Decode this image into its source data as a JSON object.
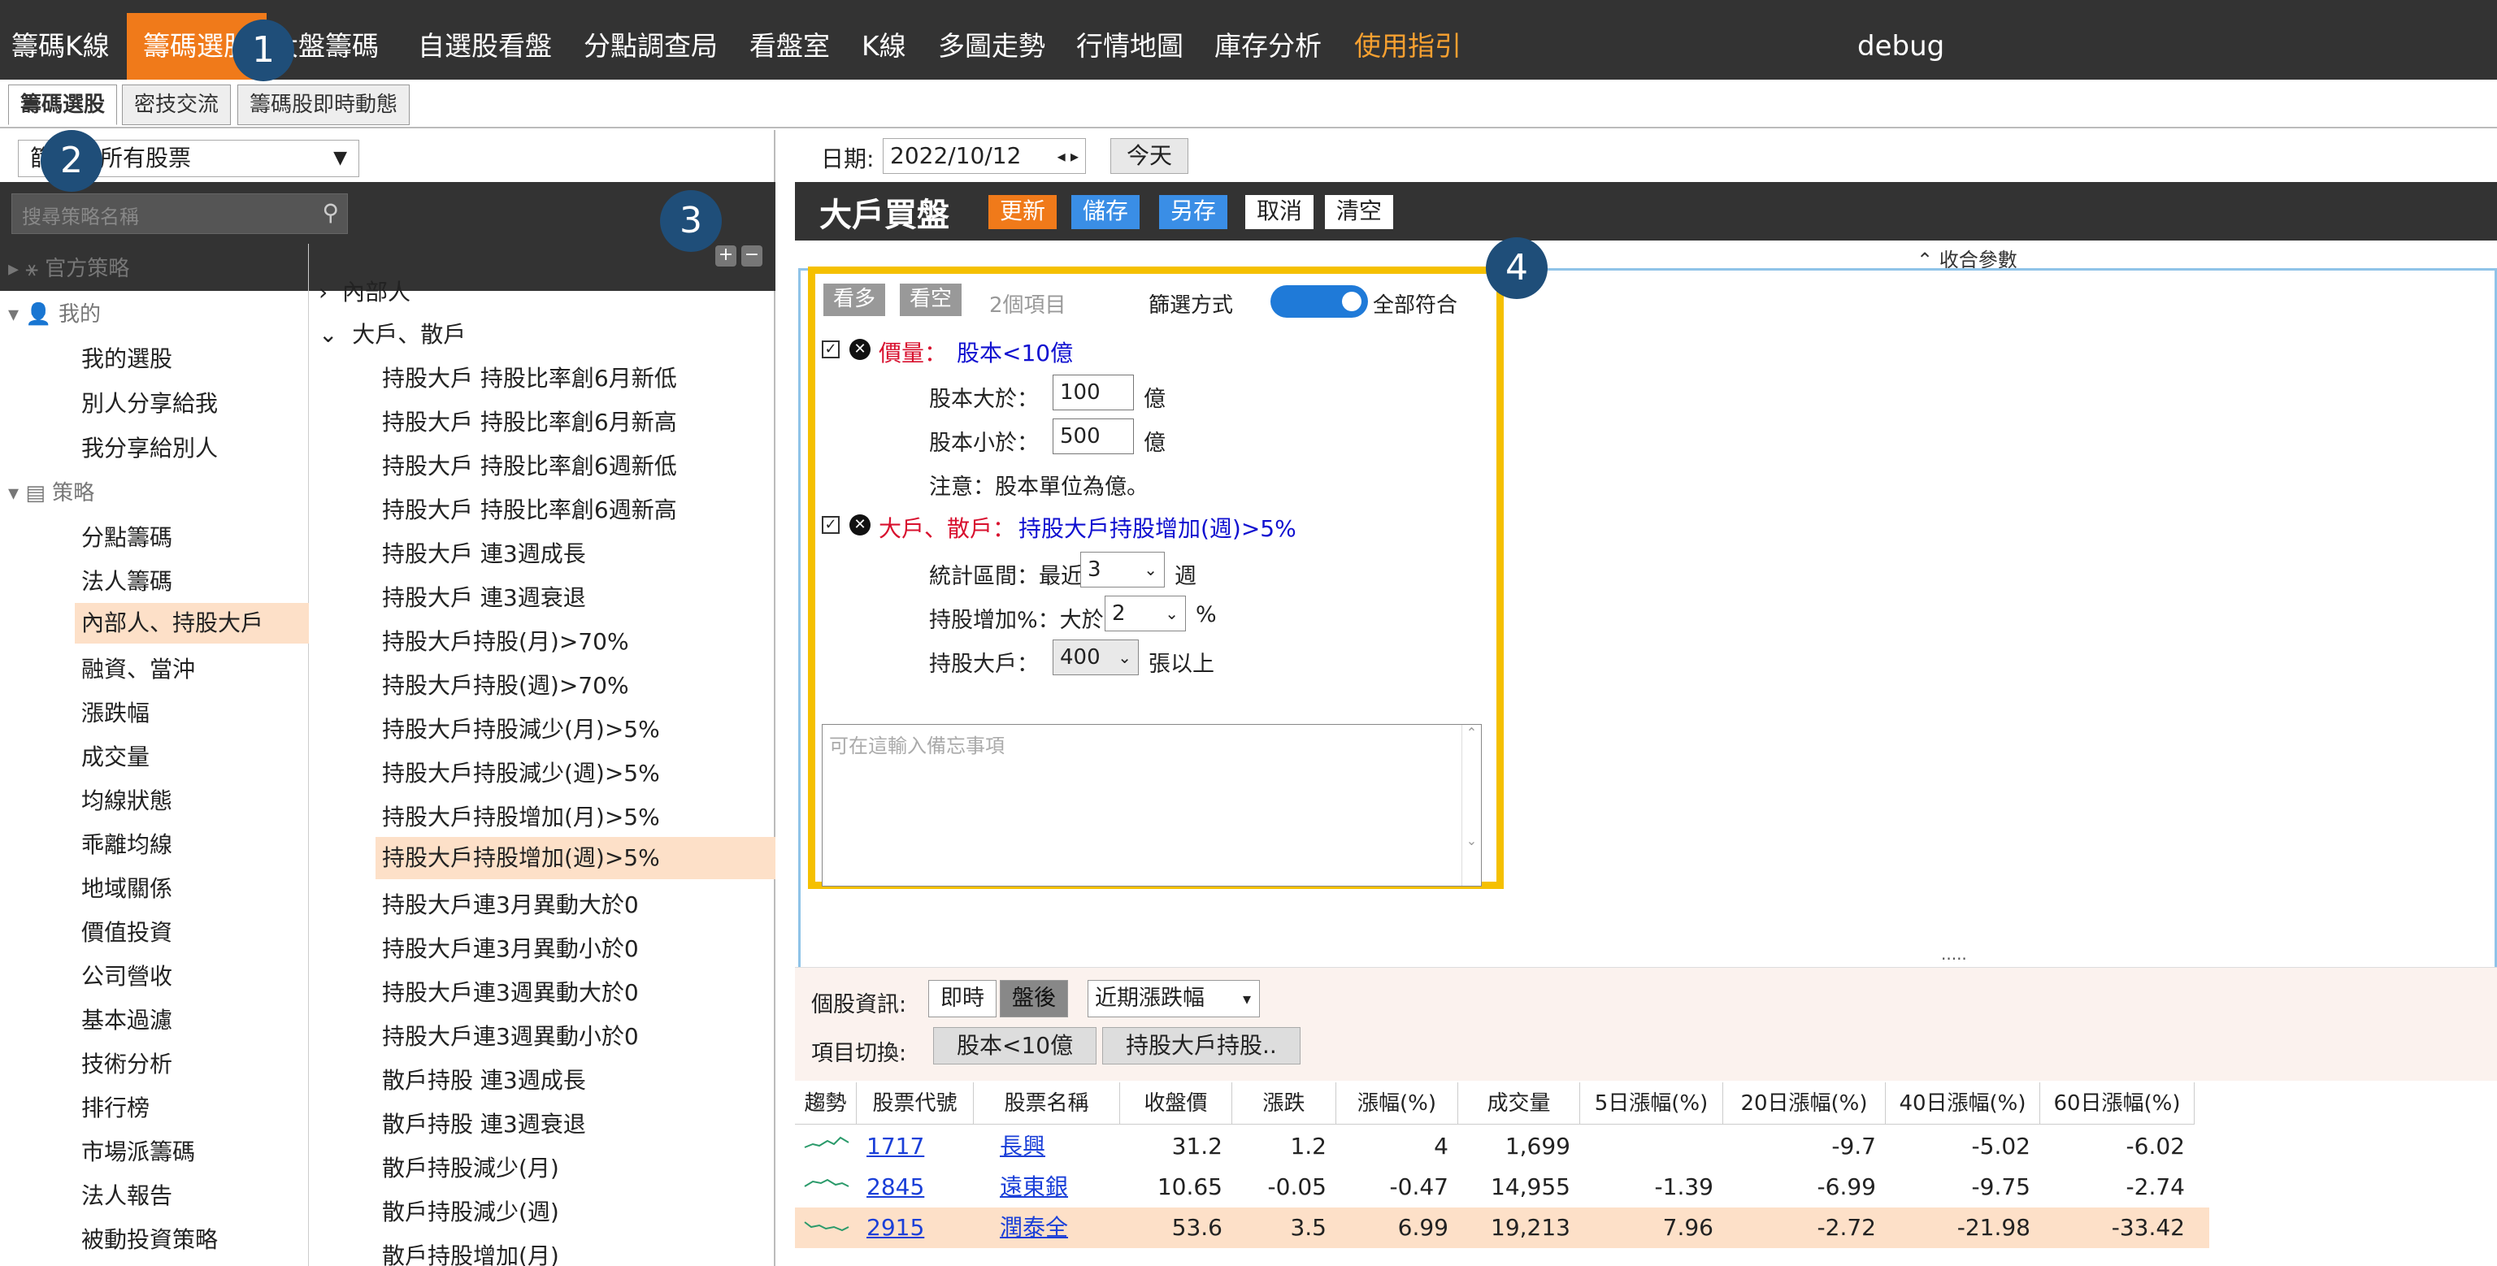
{
  "topbar": {
    "items": [
      {
        "label": "籌碼K線"
      },
      {
        "label": "籌碼選股"
      },
      {
        "label": "大盤籌碼"
      },
      {
        "label": "自選股看盤"
      },
      {
        "label": "分點調查局"
      },
      {
        "label": "看盤室"
      },
      {
        "label": "K線"
      },
      {
        "label": "多圖走勢"
      },
      {
        "label": "行情地圖"
      },
      {
        "label": "庫存分析"
      },
      {
        "label": "使用指引"
      }
    ],
    "debug": "debug"
  },
  "badges": [
    "1",
    "2",
    "3",
    "4"
  ],
  "subtabs": [
    "籌碼選股",
    "密技交流",
    "籌碼股即時動態"
  ],
  "left": {
    "select_prefix": "篩",
    "select_value": "所有股票",
    "search_placeholder": "搜尋策略名稱",
    "tree1": {
      "official": "官方策略",
      "mine": "我的",
      "mine_items": [
        "我的選股",
        "別人分享給我",
        "我分享給別人"
      ],
      "strategy": "策略",
      "strategy_items": [
        "分點籌碼",
        "法人籌碼",
        "內部人、持股大戶",
        "融資、當沖",
        "漲跌幅",
        "成交量",
        "均線狀態",
        "乖離均線",
        "地域關係",
        "價值投資",
        "公司營收",
        "基本過濾",
        "技術分析",
        "排行榜",
        "市場派籌碼",
        "法人報告",
        "被動投資策略"
      ]
    },
    "tree2": {
      "group1": "內部人",
      "group2": "大戶、散戶",
      "items": [
        "持股大戶 持股比率創6月新低",
        "持股大戶 持股比率創6月新高",
        "持股大戶 持股比率創6週新低",
        "持股大戶 持股比率創6週新高",
        "持股大戶 連3週成長",
        "持股大戶 連3週衰退",
        "持股大戶持股(月)>70%",
        "持股大戶持股(週)>70%",
        "持股大戶持股減少(月)>5%",
        "持股大戶持股減少(週)>5%",
        "持股大戶持股增加(月)>5%",
        "持股大戶持股增加(週)>5%",
        "持股大戶連3月異動大於0",
        "持股大戶連3月異動小於0",
        "持股大戶連3週異動大於0",
        "持股大戶連3週異動小於0",
        "散戶持股 連3週成長",
        "散戶持股 連3週衰退",
        "散戶持股減少(月)",
        "散戶持股減少(週)",
        "散戶持股增加(月)"
      ]
    }
  },
  "right": {
    "date_label": "日期:",
    "date_value": "2022/10/12",
    "today": "今天",
    "title": "大戶買盤",
    "buttons": {
      "update": "更新",
      "save": "儲存",
      "save_as": "另存",
      "cancel": "取消",
      "clear": "清空"
    },
    "collapse": "收合參數",
    "filter": {
      "bull": "看多",
      "bear": "看空",
      "count": "2個項目",
      "mode_label": "篩選方式",
      "mode_value": "全部符合",
      "c1_name": "價量：",
      "c1_value": "股本<10億",
      "c1_p1_label": "股本大於：",
      "c1_p1_value": "100",
      "c1_p1_unit": "億",
      "c1_p2_label": "股本小於：",
      "c1_p2_value": "500",
      "c1_p2_unit": "億",
      "c1_note": "注意：股本單位為億。",
      "c2_name": "大戶、散戶：",
      "c2_value": "持股大戶持股增加(週)>5%",
      "c2_p1_label": "統計區間：最近",
      "c2_p1_value": "3",
      "c2_p1_unit": "週",
      "c2_p2_label": "持股增加%：大於",
      "c2_p2_value": "2",
      "c2_p2_unit": "%",
      "c2_p3_label": "持股大戶：",
      "c2_p3_value": "400",
      "c2_p3_unit": "張以上",
      "memo_placeholder": "可在這輸入備忘事項"
    },
    "dots": "....."
  },
  "info": {
    "label": "個股資訊:",
    "realtime": "即時",
    "afterhours": "盤後",
    "period": "近期漲跌幅",
    "switch_label": "項目切換:",
    "switch_items": [
      "股本<10億",
      "持股大戶持股.."
    ]
  },
  "table": {
    "headers": [
      "趨勢",
      "股票代號",
      "股票名稱",
      "收盤價",
      "漲跌",
      "漲幅(%)",
      "成交量",
      "5日漲幅(%)",
      "20日漲幅(%)",
      "40日漲幅(%)",
      "60日漲幅(%)"
    ],
    "rows": [
      {
        "code": "1717",
        "name": "長興",
        "close": "31.2",
        "change": "1.2",
        "pct": "4",
        "volume": "1,699",
        "d5": "",
        "d20": "-9.7",
        "d40": "-5.02",
        "d60": "-6.02"
      },
      {
        "code": "2845",
        "name": "遠東銀",
        "close": "10.65",
        "change": "-0.05",
        "pct": "-0.47",
        "volume": "14,955",
        "d5": "-1.39",
        "d20": "-6.99",
        "d40": "-9.75",
        "d60": "-2.74"
      },
      {
        "code": "2915",
        "name": "潤泰全",
        "close": "53.6",
        "change": "3.5",
        "pct": "6.99",
        "volume": "19,213",
        "d5": "7.96",
        "d20": "-2.72",
        "d40": "-21.98",
        "d60": "-33.42"
      }
    ]
  },
  "colors": {
    "accent": "#f07a1a",
    "topbar": "#333333",
    "selection": "#fde0c8",
    "highlight": "#f5c000",
    "link": "#1a3fd8"
  }
}
